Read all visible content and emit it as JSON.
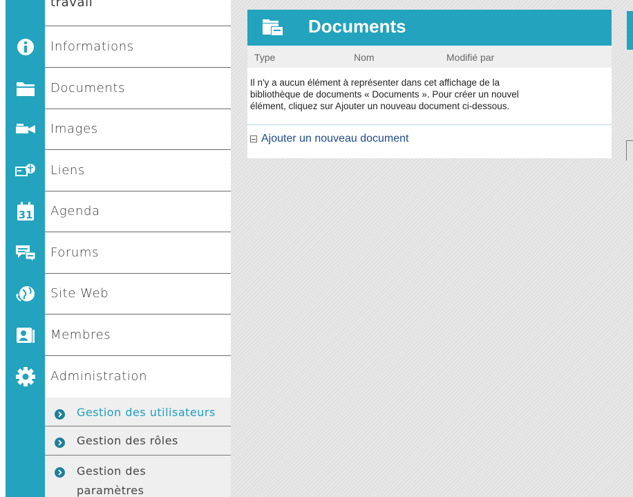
{
  "sidebar": {
    "partial_top_label": "travail",
    "items": [
      {
        "label": "Informations",
        "icon": "info-icon"
      },
      {
        "label": "Documents",
        "icon": "folder-icon"
      },
      {
        "label": "Images",
        "icon": "camera-icon"
      },
      {
        "label": "Liens",
        "icon": "link-globe-icon"
      },
      {
        "label": "Agenda",
        "icon": "calendar-icon",
        "icon_text": "31"
      },
      {
        "label": "Forums",
        "icon": "chat-icon"
      },
      {
        "label": "Site Web",
        "icon": "globe-icon"
      },
      {
        "label": "Membres",
        "icon": "members-icon"
      },
      {
        "label": "Administration",
        "icon": "gear-icon"
      }
    ],
    "sub_items": [
      {
        "label": "Gestion des utilisateurs",
        "active": true
      },
      {
        "label": "Gestion des rôles",
        "active": false
      },
      {
        "label_line1": "Gestion des",
        "label_line2": "paramètres",
        "active": false
      }
    ]
  },
  "panel": {
    "title": "Documents",
    "columns": [
      "Type",
      "Nom",
      "Modifié par"
    ],
    "empty_line1": "Il n'y a aucun élément à représenter dans cet affichage de la",
    "empty_line2": "bibliothèque de documents « Documents ». Pour créer un nouvel",
    "empty_line3": "élément, cliquez sur Ajouter un nouveau document ci-dessous.",
    "add_label": "Ajouter un nouveau document"
  },
  "colors": {
    "accent": "#23a3bd",
    "active_sub": "#1e9fbe",
    "link": "#1d4a8a"
  }
}
